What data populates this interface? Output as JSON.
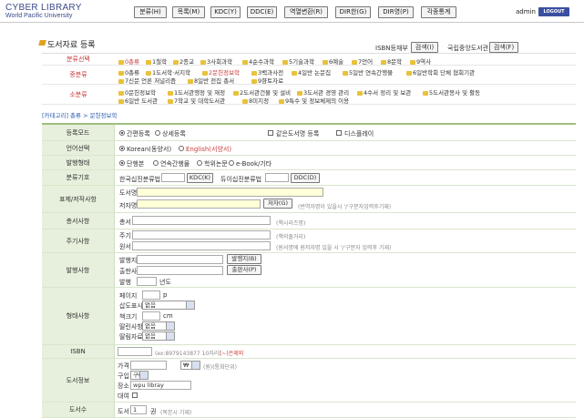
{
  "app": {
    "title": "CYBER LIBRARY",
    "subtitle": "World Pacific University"
  },
  "toolbar": {
    "buttons": [
      "분류(H)",
      "목록(M)",
      "KDC(Y)",
      "DDC(E)",
      "역열변환(R)",
      "DIR한(G)",
      "DIR영(P)",
      "각종통계"
    ]
  },
  "user": {
    "name": "admin",
    "logout": "LOGOUT"
  },
  "page": {
    "title": "도서자료 등록",
    "isbn_label": "ISBN등재부",
    "search_button": "검색(I)",
    "national_label": "국립중앙도서관",
    "national_button": "검색(F)"
  },
  "category": {
    "main_label": "분류선택",
    "mid_label": "중분류",
    "sub_label": "소분류",
    "main": [
      "0총류",
      "1철학",
      "2종교",
      "3사회과학",
      "4순수과학",
      "5기술과학",
      "6예술",
      "7언어",
      "8문학",
      "9역사"
    ],
    "mid_row1": [
      "0총류",
      "1도서학·서지학",
      "2문헌정보학",
      "3백과사전",
      "4일반 논문집",
      "5일반 연속간행물",
      "6일반학회 단체 협회기관"
    ],
    "mid_row2": [
      "7신문 언론 저널리즘",
      "8일반 전집 총서",
      "9향토자료"
    ],
    "sub_row1": [
      "0문헌정보학",
      "1도서관행정 및 재정",
      "2도서관건물 및 설비",
      "3도서관 경영 관리",
      "4수서 정리 및 보관",
      "5도서관봉사 및 활동"
    ],
    "sub_row2": [
      "6일반 도서관",
      "7학교 및 대학도서관",
      "8미지정",
      "9특수 및 정보체제의 이용"
    ]
  },
  "breadcrumb": "[카테고리] 총류 > 문헌정보학",
  "form": {
    "reg_mode": {
      "label": "등록모드",
      "opt1": "간편등록",
      "opt2": "상세등록",
      "chk1": "같은도서명 등록",
      "chk2": "디스플레이"
    },
    "language": {
      "label": "언어선택",
      "opt1": "Korean(동양서)",
      "opt2": "English(서양서)"
    },
    "pubtype": {
      "label": "발행형태",
      "opts": [
        "단행본",
        "연속간행물",
        "학위논문",
        "e-Book/기타"
      ]
    },
    "classcode": {
      "label": "분류기호",
      "kdc_label": "한국십진분류법",
      "kdc_btn": "KDC(K)",
      "ddc_label": "듀이십진분류법",
      "ddc_btn": "DDC(D)"
    },
    "title_author": {
      "label": "표제/저작사항",
      "title_lbl": "도서명",
      "author_lbl": "저자명",
      "author_btn": "저자(G)",
      "author_hint": "(번역자명이 있을시 '/'구분자입력후기재)"
    },
    "series": {
      "label": "총서사항",
      "lbl": "총서",
      "hint": "(책시리즈명)"
    },
    "notes": {
      "label": "주기사항",
      "note_lbl": "주기",
      "note_hint": "(책의줄거리)",
      "orig_lbl": "원서",
      "orig_hint": "(원서명에 원저자명 있을 시 '/'구분자 입력후 기재)"
    },
    "publish": {
      "label": "발행사항",
      "place_lbl": "발행지",
      "place_btn": "발행지(B)",
      "pub_lbl": "출판사",
      "pub_btn": "출판사(P)",
      "year_lbl": "발행",
      "year_unit": "년도"
    },
    "physical": {
      "label": "형태사항",
      "pages_lbl": "페이지",
      "pages_unit": "p",
      "illus_lbl": "삽도표시",
      "illus_val": "없음",
      "size_lbl": "책크기",
      "size_unit": "cm",
      "attach_lbl": "딸린사항",
      "attach_val": "없음",
      "media_lbl": "딸림자료",
      "media_val": "없음"
    },
    "isbn": {
      "label": "ISBN",
      "hint": "(ex:8979143877 10자리)",
      "warn": "(~)은제외"
    },
    "acquire": {
      "label": "도서정보",
      "price_lbl": "가격",
      "currency": "₩",
      "price_hint": "(원)(통화단위)",
      "method_lbl": "구입",
      "method_val": "구매",
      "loc_lbl": "장소",
      "loc_val": "wpu libray",
      "loan_lbl": "대여"
    },
    "copies": {
      "label": "도서수",
      "lbl": "도서",
      "val": "1",
      "unit": "권",
      "hint": "(복본시 기재)"
    }
  }
}
